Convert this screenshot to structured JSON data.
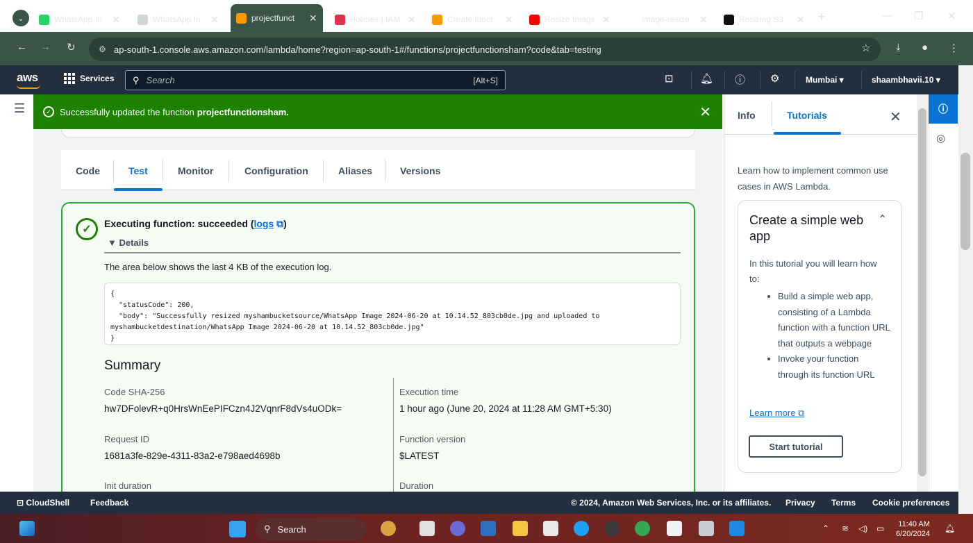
{
  "browser": {
    "tabs": [
      {
        "label": "WhatsApp In",
        "color": "#25d366"
      },
      {
        "label": "WhatsApp In",
        "color": "#cfd6d3"
      },
      {
        "label": "projectfunct",
        "color": "#ff9900"
      },
      {
        "label": "Policies | IAM",
        "color": "#dd344c"
      },
      {
        "label": "Create funct",
        "color": "#ff9900"
      },
      {
        "label": "Resize Image",
        "color": "#ff0000"
      },
      {
        "label": "image-resize",
        "color": "#ffffff"
      },
      {
        "label": "Resizing S3",
        "color": "#111111"
      }
    ],
    "new_tab": "+",
    "url": "ap-south-1.console.aws.amazon.com/lambda/home?region=ap-south-1#/functions/projectfunctionsham?code&tab=testing"
  },
  "aws_nav": {
    "logo": "aws",
    "services": "Services",
    "search_placeholder": "Search",
    "search_shortcut": "[Alt+S]",
    "region": "Mumbai ▾",
    "user": "shaambhavii.10 ▾"
  },
  "flash": {
    "prefix": "Successfully updated the function",
    "function_name": "projectfunctionsham."
  },
  "tabs": [
    "Code",
    "Test",
    "Monitor",
    "Configuration",
    "Aliases",
    "Versions"
  ],
  "active_tab": "Test",
  "result": {
    "title": "Executing function: succeeded (",
    "logs_link": "logs",
    "title_end": ")",
    "details": "▼  Details",
    "log_description": "The area below shows the last 4 KB of the execution log.",
    "log_text": "{\n  \"statusCode\": 200,\n  \"body\": \"Successfully resized myshambucketsource/WhatsApp Image 2024-06-20 at 10.14.52_803cb0de.jpg and uploaded to\nmyshambucketdestination/WhatsApp Image 2024-06-20 at 10.14.52_803cb0de.jpg\"\n}"
  },
  "summary": {
    "heading": "Summary",
    "code_sha_label": "Code SHA-256",
    "code_sha_value": "hw7DFolevR+q0HrsWnEePIFCzn4J2VqnrF8dVs4uODk=",
    "exec_time_label": "Execution time",
    "exec_time_value": "1 hour ago (June 20, 2024 at 11:28 AM GMT+5:30)",
    "request_id_label": "Request ID",
    "request_id_value": "1681a3fe-829e-4311-83a2-e798aed4698b",
    "func_version_label": "Function version",
    "func_version_value": "$LATEST",
    "init_duration_label": "Init duration",
    "duration_label": "Duration"
  },
  "panel": {
    "tab_info": "Info",
    "tab_tutorials": "Tutorials",
    "intro": "Learn how to implement common use cases in AWS Lambda.",
    "card_title": "Create a simple web app",
    "card_intro": "In this tutorial you will learn how to:",
    "bullets": [
      "Build a simple web app, consisting of a Lambda function with a function URL that outputs a webpage",
      "Invoke your function through its function URL"
    ],
    "learn_more": "Learn more",
    "start_button": "Start tutorial"
  },
  "footer": {
    "cloudshell": "CloudShell",
    "feedback": "Feedback",
    "copyright": "© 2024, Amazon Web Services, Inc. or its affiliates.",
    "privacy": "Privacy",
    "terms": "Terms",
    "cookies": "Cookie preferences"
  },
  "taskbar": {
    "search": "Search",
    "time": "11:40 AM",
    "date": "6/20/2024"
  }
}
